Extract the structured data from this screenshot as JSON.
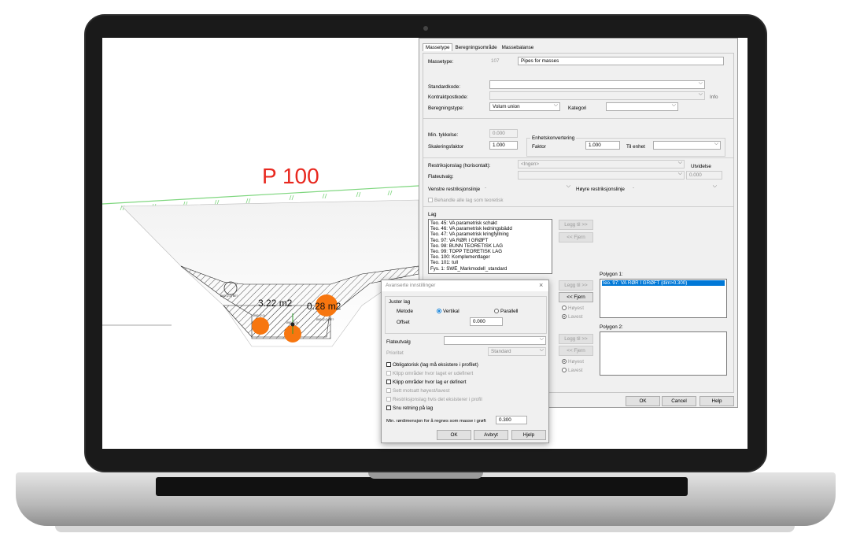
{
  "drawing": {
    "title": "P 100",
    "area1": "3.22 m2",
    "area2": "0.28 m2",
    "small_labels": [
      "Ø63 (2.0) BE?",
      "Ø63 (2.0) BE?",
      "Ø63 (2.0)",
      "Ø63 (2.0)"
    ]
  },
  "dialog": {
    "tabs": [
      "Massetype",
      "Beregningsområde",
      "Massebalanse"
    ],
    "massetype_label": "Massetype:",
    "massetype_num": "107",
    "massetype_name": "Pipes for masses",
    "standardkode_label": "Standardkode:",
    "kontraktpostkode_label": "Kontraktpostkode:",
    "info_label": "Info",
    "beregningstype_label": "Beregningstype:",
    "beregningstype_value": "Volum union",
    "kategori_label": "Kategori",
    "min_tykkelse_label": "Min. tykkelse:",
    "min_tykkelse_value": "0.000",
    "enhetskonvertering_label": "Enhetskonvertering",
    "skaleringsfaktor_label": "Skaleringsfaktor",
    "skaleringsfaktor_value": "1.000",
    "faktor_label": "Faktor",
    "faktor_value": "1.000",
    "til_enhet_label": "Til enhet",
    "restriksjonslag_label": "Restriksjonslag (horisontalt):",
    "restriksjonslag_value": "<Ingen>",
    "utvidelse_label": "Utvidelse",
    "flateutvalg_label": "Flateutvalg:",
    "utvidelse_value": "0.000",
    "venstre_label": "Venstre restriksjonslinje",
    "venstre_value": "-",
    "hoyre_label": "Høyre restriksjonslinje",
    "hoyre_value": "-",
    "behandle_label": "Behandle alle lag som teoretisk",
    "lag_label": "Lag",
    "lag_items": [
      "Teo.  45: VA parametrisk schakt",
      "Teo.  46: VA parametrisk ledningsbädd",
      "Teo.  47: VA parametrisk kringfyllning",
      "Teo.  97: VA RØR I GRØFT",
      "Teo.  98: BUNN TEORETISK LAG",
      "Teo.  99: TOPP TEORETISK LAG",
      "Teo. 100: Komplementlager",
      "Teo. 101: tull",
      "Fys.   1: SWE_Markmodell_standard"
    ],
    "legg_til_label": "Legg til >>",
    "fjern_label": "<< Fjern",
    "polygon1_label": "Polygon 1:",
    "polygon1_item": "Teo.  97: VA RØR I GRØFT (dim>0.300)",
    "polygon2_label": "Polygon 2:",
    "hoyest_label": "Høyest",
    "lavest_label": "Lavest",
    "ok_label": "OK",
    "cancel_label": "Cancel",
    "help_label": "Help"
  },
  "advanced": {
    "title": "Avanserte innstillinger",
    "juster_lag_label": "Juster lag",
    "metode_label": "Metode",
    "vertikal_label": "Vertikal",
    "parallell_label": "Parallell",
    "offset_label": "Offset",
    "offset_value": "0.000",
    "flateutvalg_label": "Flateutvalg",
    "prioritet_label": "Prioritet",
    "prioritet_value": "Standard",
    "checkboxes": [
      "Obligatorisk (lag må eksistere i profilet)",
      "Klipp områder hvor laget er udefinert",
      "Klipp områder hvor lag er definert",
      "Sett motsatt høyest/lavest",
      "Restriksjonslag hvis det eksisterer i profil",
      "Snu retning på lag"
    ],
    "min_rordim_label": "Min. rørdimensjon for å regnes som masse i grøft",
    "min_rordim_value": "0.300",
    "ok_label": "OK",
    "avbryt_label": "Avbryt",
    "hjelp_label": "Hjelp"
  },
  "colors": {
    "accent_red": "#e8281f",
    "pipe_orange": "#f7760f",
    "ground_green": "#7ed67e",
    "selection_blue": "#0078d7"
  }
}
